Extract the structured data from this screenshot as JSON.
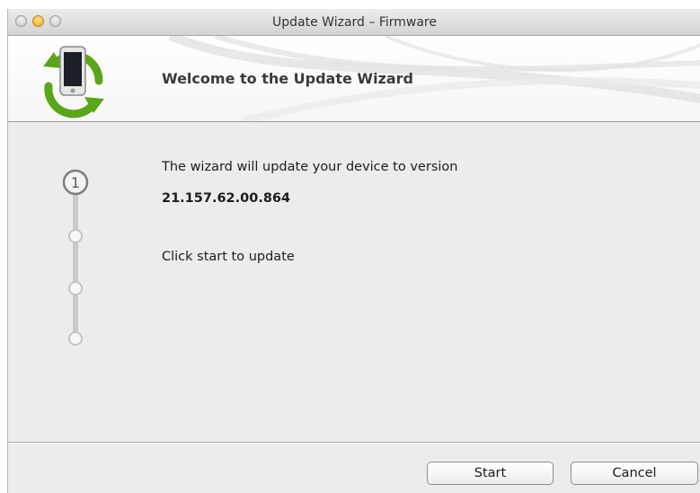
{
  "window": {
    "title": "Update Wizard – Firmware"
  },
  "header": {
    "heading": "Welcome to the Update Wizard",
    "icon": "phone-sync-icon"
  },
  "steps": {
    "current_number": "1",
    "total": 4
  },
  "content": {
    "description": "The wizard will update your device to version",
    "version": "21.157.62.00.864",
    "hint": "Click start to update"
  },
  "buttons": {
    "start_label": "Start",
    "cancel_label": "Cancel"
  },
  "colors": {
    "sync_arrow_green": "#5aa619",
    "window_bg": "#ececec"
  }
}
